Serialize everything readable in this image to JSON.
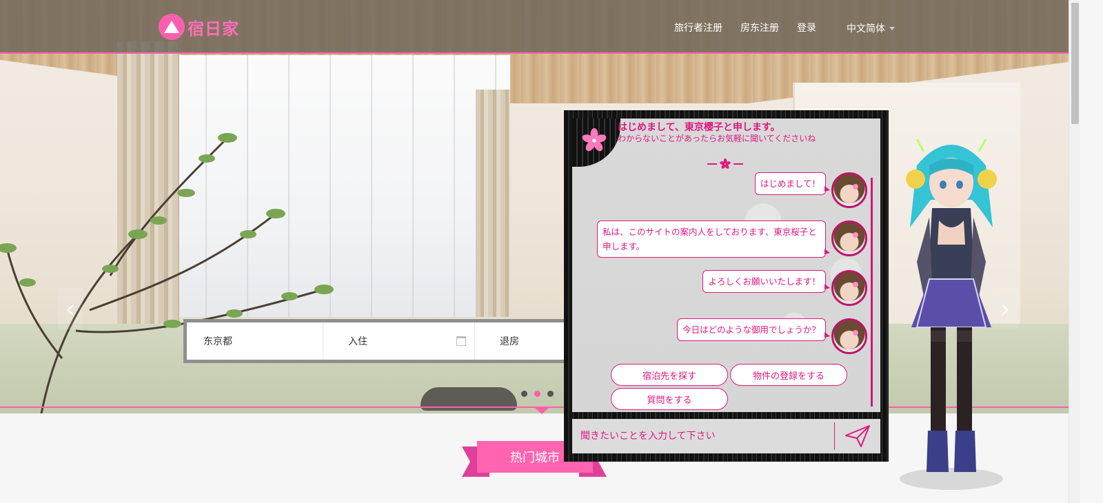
{
  "brand": {
    "logo_text": "宿日家",
    "accent": "#ff5fae"
  },
  "nav": {
    "links": [
      "旅行者注册",
      "房东注册",
      "登录"
    ],
    "language": "中文简体"
  },
  "search": {
    "city": "东京都",
    "checkin": "入住",
    "checkout": "退房"
  },
  "carousel": {
    "slide_count": 3,
    "active_index": 1
  },
  "section": {
    "title": "热门城市"
  },
  "chat": {
    "title": "はじめまして、東京櫻子と申します。",
    "subtitle": "わからないことがあったらお気軽に聞いてくださいね",
    "messages": [
      "はじめまして！",
      "私は、このサイトの案内人をしております、東京桜子と申します。",
      "よろしくお願いいたします！",
      "今日はどのような御用でしょうか？"
    ],
    "quick_replies": [
      "宿泊先を探す",
      "物件の登録をする",
      "質問をする"
    ],
    "input_placeholder": "聞きたいことを入力して下さい",
    "colors": {
      "text": "#e0187f",
      "panel": "#d9d9d9",
      "frame": "#111111"
    }
  },
  "icons": [
    "logo-mountain-icon",
    "calendar-icon",
    "sakura-icon",
    "send-icon",
    "chevron-left-icon",
    "chevron-right-icon",
    "caret-down-icon"
  ]
}
